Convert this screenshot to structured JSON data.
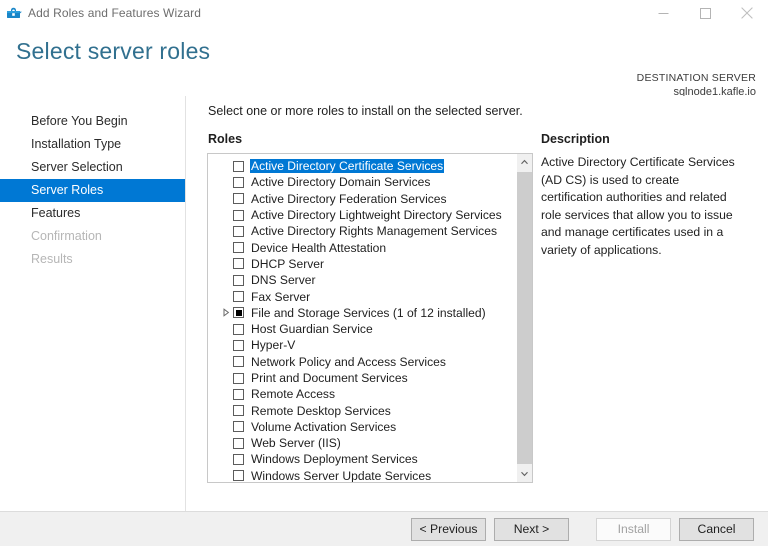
{
  "window": {
    "title": "Add Roles and Features Wizard",
    "icon": "toolbox-icon",
    "controls": {
      "minimize": "minimize-icon",
      "maximize": "maximize-icon",
      "close": "close-icon"
    }
  },
  "header": {
    "page_title": "Select server roles",
    "destination_label": "DESTINATION SERVER",
    "destination_value": "sqlnode1.kafle.io",
    "title_color": "#31708f"
  },
  "sidebar": {
    "items": [
      {
        "label": "Before You Begin",
        "state": "normal"
      },
      {
        "label": "Installation Type",
        "state": "normal"
      },
      {
        "label": "Server Selection",
        "state": "normal"
      },
      {
        "label": "Server Roles",
        "state": "selected"
      },
      {
        "label": "Features",
        "state": "normal"
      },
      {
        "label": "Confirmation",
        "state": "disabled"
      },
      {
        "label": "Results",
        "state": "disabled"
      }
    ],
    "selected_color": "#0078d4"
  },
  "main": {
    "instruction": "Select one or more roles to install on the selected server.",
    "roles_label": "Roles",
    "description_label": "Description",
    "description_text": "Active Directory Certificate Services (AD CS) is used to create certification authorities and related role services that allow you to issue and manage certificates used in a variety of applications.",
    "roles": [
      {
        "label": "Active Directory Certificate Services",
        "checked": "unchecked",
        "selected": true,
        "expandable": false
      },
      {
        "label": "Active Directory Domain Services",
        "checked": "unchecked",
        "selected": false,
        "expandable": false
      },
      {
        "label": "Active Directory Federation Services",
        "checked": "unchecked",
        "selected": false,
        "expandable": false
      },
      {
        "label": "Active Directory Lightweight Directory Services",
        "checked": "unchecked",
        "selected": false,
        "expandable": false
      },
      {
        "label": "Active Directory Rights Management Services",
        "checked": "unchecked",
        "selected": false,
        "expandable": false
      },
      {
        "label": "Device Health Attestation",
        "checked": "unchecked",
        "selected": false,
        "expandable": false
      },
      {
        "label": "DHCP Server",
        "checked": "unchecked",
        "selected": false,
        "expandable": false
      },
      {
        "label": "DNS Server",
        "checked": "unchecked",
        "selected": false,
        "expandable": false
      },
      {
        "label": "Fax Server",
        "checked": "unchecked",
        "selected": false,
        "expandable": false
      },
      {
        "label": "File and Storage Services (1 of 12 installed)",
        "checked": "partial",
        "selected": false,
        "expandable": true
      },
      {
        "label": "Host Guardian Service",
        "checked": "unchecked",
        "selected": false,
        "expandable": false
      },
      {
        "label": "Hyper-V",
        "checked": "unchecked",
        "selected": false,
        "expandable": false
      },
      {
        "label": "Network Policy and Access Services",
        "checked": "unchecked",
        "selected": false,
        "expandable": false
      },
      {
        "label": "Print and Document Services",
        "checked": "unchecked",
        "selected": false,
        "expandable": false
      },
      {
        "label": "Remote Access",
        "checked": "unchecked",
        "selected": false,
        "expandable": false
      },
      {
        "label": "Remote Desktop Services",
        "checked": "unchecked",
        "selected": false,
        "expandable": false
      },
      {
        "label": "Volume Activation Services",
        "checked": "unchecked",
        "selected": false,
        "expandable": false
      },
      {
        "label": "Web Server (IIS)",
        "checked": "unchecked",
        "selected": false,
        "expandable": false
      },
      {
        "label": "Windows Deployment Services",
        "checked": "unchecked",
        "selected": false,
        "expandable": false
      },
      {
        "label": "Windows Server Update Services",
        "checked": "unchecked",
        "selected": false,
        "expandable": false
      }
    ],
    "scrollbar": {
      "up_arrow": "chevron-up-icon",
      "down_arrow": "chevron-down-icon"
    }
  },
  "footer": {
    "buttons": [
      {
        "label": "< Previous",
        "enabled": true
      },
      {
        "label": "Next >",
        "enabled": true
      },
      {
        "label": "Install",
        "enabled": false
      },
      {
        "label": "Cancel",
        "enabled": true
      }
    ]
  }
}
